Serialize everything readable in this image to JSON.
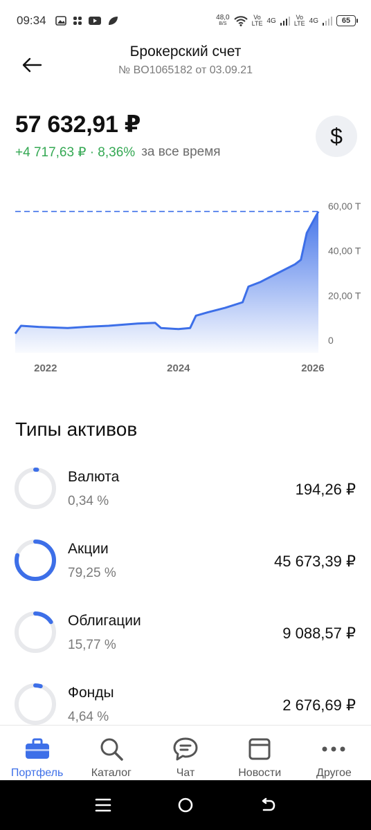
{
  "status_bar": {
    "time": "09:34",
    "speed_value": "48,0",
    "speed_unit": "B/S",
    "net1_top": "Vo",
    "net1_bottom": "LTE",
    "net1_type": "4G",
    "net2_top": "Vo",
    "net2_bottom": "LTE",
    "net2_type": "4G",
    "battery": "65",
    "icons": [
      "photo-icon",
      "slack-icon",
      "youtube-icon",
      "leaf-icon",
      "wifi-icon",
      "signal-icon"
    ]
  },
  "header": {
    "title": "Брокерский счет",
    "subtitle": "№ BO1065182 от 03.09.21"
  },
  "summary": {
    "balance": "57 632,91 ₽",
    "change": "+4 717,63 ₽ · 8,36%",
    "change_period": "за все время",
    "currency_symbol": "$"
  },
  "colors": {
    "accent": "#3d6fe8",
    "positive": "#34a853",
    "ring_track": "#e8e9ec"
  },
  "chart_data": {
    "type": "area",
    "y_ticks": [
      "60,00 Т",
      "40,00 Т",
      "20,00 Т",
      "0"
    ],
    "x_ticks": [
      "2022",
      "2024",
      "2026"
    ],
    "ylim": [
      0,
      60000
    ],
    "reference_line": 57632.91,
    "series": [
      {
        "x": [
          "2021-09",
          "2021-10",
          "2022-01",
          "2022-06",
          "2022-09",
          "2023-01",
          "2023-06",
          "2023-09",
          "2023-10",
          "2024-01",
          "2024-03",
          "2024-04",
          "2024-06",
          "2024-09",
          "2024-12",
          "2025-01",
          "2025-03",
          "2025-06",
          "2025-09",
          "2025-10",
          "2025-11",
          "2026-01"
        ],
        "values": [
          3000,
          6500,
          6000,
          5500,
          6000,
          6500,
          7500,
          7800,
          5500,
          5000,
          5500,
          11000,
          12500,
          14500,
          17000,
          24000,
          26000,
          30000,
          34000,
          36000,
          48000,
          57600
        ]
      }
    ]
  },
  "assets": {
    "title": "Типы активов",
    "items": [
      {
        "name": "Валюта",
        "percent": "0,34 %",
        "value": "194,26 ₽",
        "share": 0.0034
      },
      {
        "name": "Акции",
        "percent": "79,25 %",
        "value": "45 673,39 ₽",
        "share": 0.7925
      },
      {
        "name": "Облигации",
        "percent": "15,77 %",
        "value": "9 088,57 ₽",
        "share": 0.1577
      },
      {
        "name": "Фонды",
        "percent": "4,64 %",
        "value": "2 676,69 ₽",
        "share": 0.0464
      }
    ]
  },
  "bottom_nav": {
    "items": [
      {
        "label": "Портфель",
        "icon": "briefcase-icon",
        "active": true
      },
      {
        "label": "Каталог",
        "icon": "search-icon",
        "active": false
      },
      {
        "label": "Чат",
        "icon": "chat-icon",
        "active": false
      },
      {
        "label": "Новости",
        "icon": "news-icon",
        "active": false
      },
      {
        "label": "Другое",
        "icon": "more-icon",
        "active": false
      }
    ]
  },
  "system_nav": {
    "icons": [
      "menu-icon",
      "home-icon",
      "back-icon"
    ]
  }
}
